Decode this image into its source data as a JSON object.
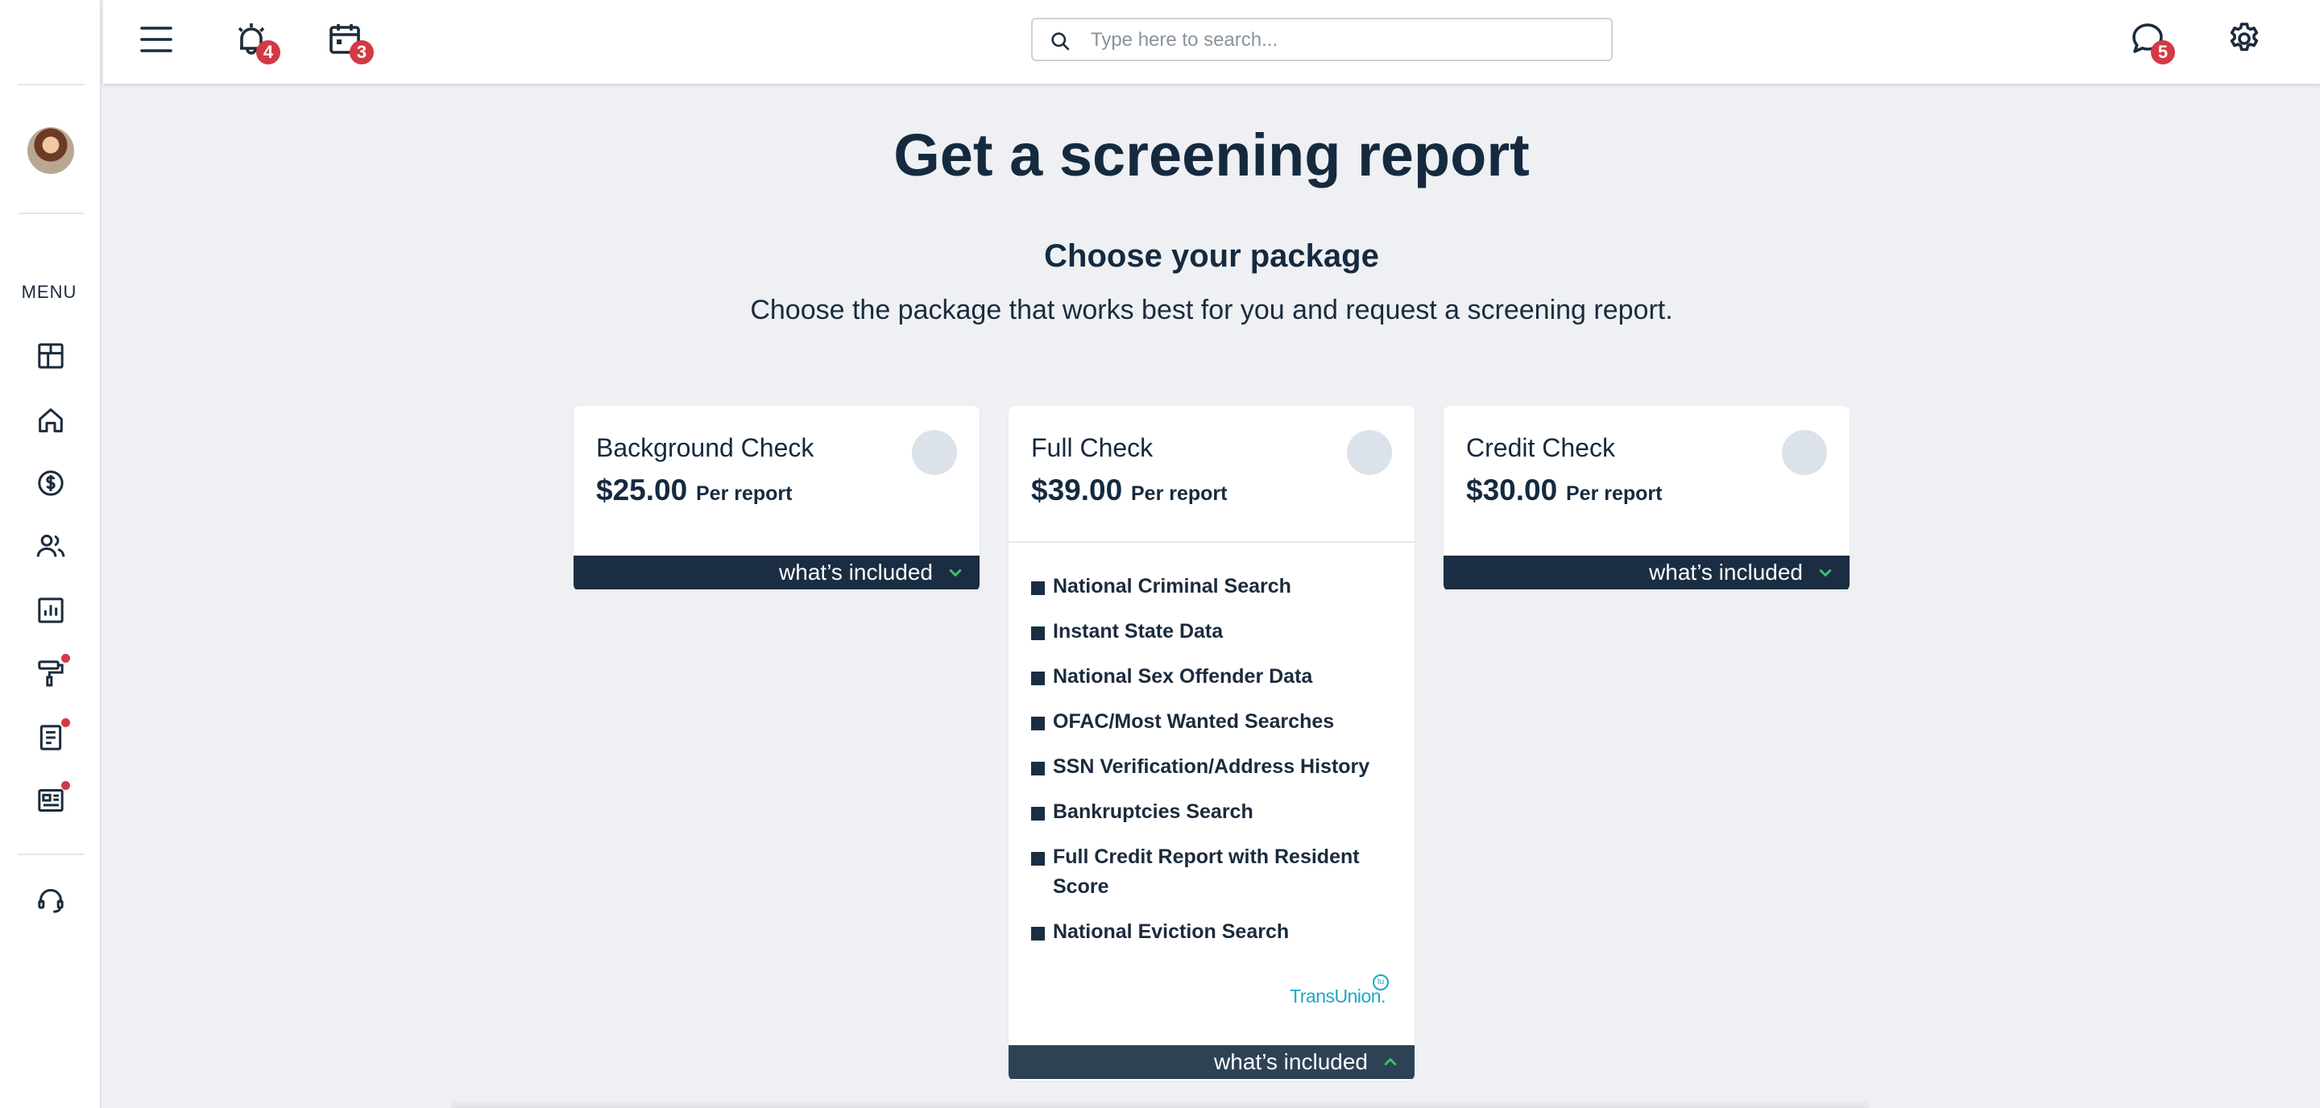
{
  "sidebar": {
    "menu_label": "MENU",
    "items": [
      {
        "icon": "dashboard-icon"
      },
      {
        "icon": "home-icon"
      },
      {
        "icon": "dollar-icon"
      },
      {
        "icon": "users-icon"
      },
      {
        "icon": "chart-icon"
      },
      {
        "icon": "paint-roller-icon",
        "has_dot": true
      },
      {
        "icon": "document-icon",
        "has_dot": true
      },
      {
        "icon": "newspaper-icon",
        "has_dot": true
      },
      {
        "icon": "headset-icon"
      }
    ]
  },
  "topbar": {
    "alarm_badge": "4",
    "calendar_badge": "3",
    "messages_badge": "5",
    "search_placeholder": "Type here to search..."
  },
  "main": {
    "title": "Get a screening report",
    "subtitle": "Choose your package",
    "description": "Choose the package that works best for you and request a screening report."
  },
  "packages": [
    {
      "name": "Background Check",
      "price": "$25.00",
      "per": "Per report",
      "toggle_label": "what’s included",
      "expanded": false
    },
    {
      "name": "Full Check",
      "price": "$39.00",
      "per": "Per report",
      "toggle_label": "what’s included",
      "expanded": true,
      "features": [
        "National Criminal Search",
        "Instant State Data",
        "National Sex Offender Data",
        "OFAC/Most Wanted Searches",
        "SSN Verification/Address History",
        "Bankruptcies Search",
        "Full Credit Report with Resident Score",
        "National Eviction Search"
      ],
      "provider_logo": "TransUnion."
    },
    {
      "name": "Credit Check",
      "price": "$30.00",
      "per": "Per report",
      "toggle_label": "what’s included",
      "expanded": false
    }
  ],
  "colors": {
    "navy": "#1b2d42",
    "badge_red": "#d33a43",
    "accent_green": "#3fbf6f",
    "transunion_teal": "#1aa9c3"
  }
}
